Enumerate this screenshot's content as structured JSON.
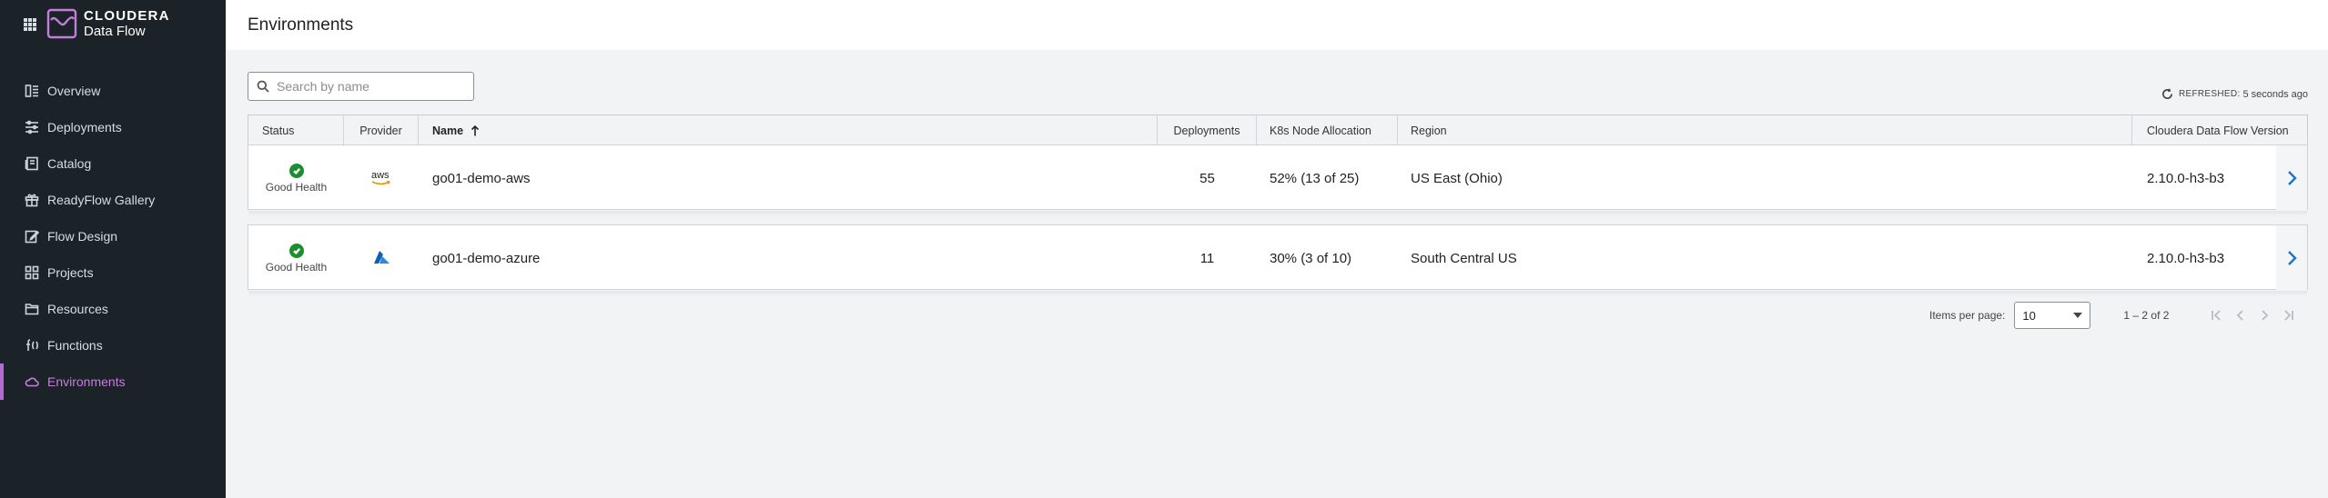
{
  "brand": {
    "line1": "CLOUDERA",
    "line2": "Data Flow"
  },
  "sidebar": {
    "items": [
      {
        "label": "Overview",
        "icon": "overview-icon"
      },
      {
        "label": "Deployments",
        "icon": "deployments-icon"
      },
      {
        "label": "Catalog",
        "icon": "catalog-icon"
      },
      {
        "label": "ReadyFlow Gallery",
        "icon": "gift-icon"
      },
      {
        "label": "Flow Design",
        "icon": "edit-icon"
      },
      {
        "label": "Projects",
        "icon": "projects-icon"
      },
      {
        "label": "Resources",
        "icon": "folder-icon"
      },
      {
        "label": "Functions",
        "icon": "function-icon"
      },
      {
        "label": "Environments",
        "icon": "cloud-icon",
        "active": true
      }
    ]
  },
  "header": {
    "title": "Environments"
  },
  "search": {
    "placeholder": "Search by name"
  },
  "refresh": {
    "label": "REFRESHED:",
    "value": "5 seconds ago"
  },
  "table": {
    "columns": {
      "status": "Status",
      "provider": "Provider",
      "name": "Name",
      "deployments": "Deployments",
      "k8s": "K8s Node Allocation",
      "region": "Region",
      "version": "Cloudera Data Flow Version"
    },
    "rows": [
      {
        "status": "Good Health",
        "provider": "aws",
        "name": "go01-demo-aws",
        "deployments": "55",
        "k8s": "52% (13 of 25)",
        "region": "US East (Ohio)",
        "version": "2.10.0-h3-b3"
      },
      {
        "status": "Good Health",
        "provider": "azure",
        "name": "go01-demo-azure",
        "deployments": "11",
        "k8s": "30% (3 of 10)",
        "region": "South Central US",
        "version": "2.10.0-h3-b3"
      }
    ]
  },
  "pagination": {
    "items_per_page_label": "Items per page:",
    "items_per_page": "10",
    "range": "1 – 2 of 2"
  },
  "colors": {
    "sidebar_bg": "#1b2329",
    "accent": "#b46ad2",
    "status_good": "#1d8e30",
    "link": "#1a73c7"
  }
}
